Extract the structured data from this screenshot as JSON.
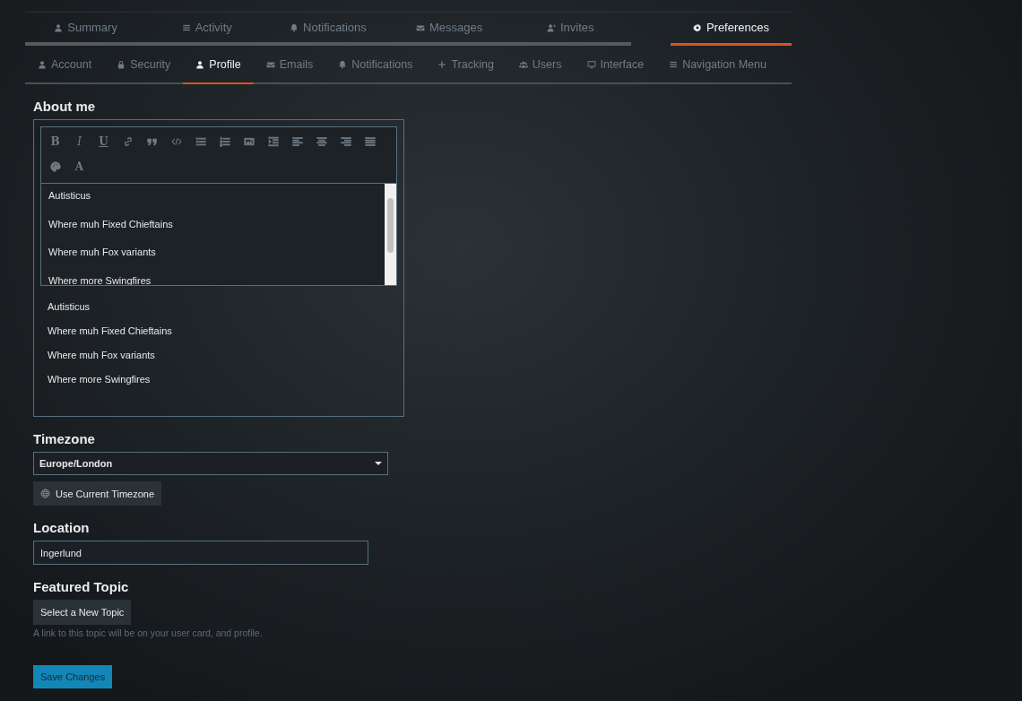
{
  "main_tabs": [
    {
      "label": "Summary",
      "kind": "user",
      "selected": false
    },
    {
      "label": "Activity",
      "kind": "list",
      "selected": false
    },
    {
      "label": "Notifications",
      "kind": "bell",
      "selected": false
    },
    {
      "label": "Messages",
      "kind": "envelope",
      "selected": false
    },
    {
      "label": "Invites",
      "kind": "user-plus",
      "selected": false
    },
    {
      "label": "Preferences",
      "kind": "gear",
      "selected": true
    }
  ],
  "sub_tabs": [
    {
      "label": "Account",
      "kind": "user",
      "selected": false
    },
    {
      "label": "Security",
      "kind": "lock",
      "selected": false
    },
    {
      "label": "Profile",
      "kind": "user",
      "selected": true
    },
    {
      "label": "Emails",
      "kind": "envelope",
      "selected": false
    },
    {
      "label": "Notifications",
      "kind": "bell",
      "selected": false
    },
    {
      "label": "Tracking",
      "kind": "plus",
      "selected": false
    },
    {
      "label": "Users",
      "kind": "users",
      "selected": false
    },
    {
      "label": "Interface",
      "kind": "monitor",
      "selected": false
    },
    {
      "label": "Navigation Menu",
      "kind": "list",
      "selected": false
    }
  ],
  "about_me": {
    "title": "About me",
    "toolbar": [
      {
        "kind": "bold",
        "text": "B"
      },
      {
        "kind": "italic",
        "text": "I"
      },
      {
        "kind": "underline",
        "text": "U"
      },
      {
        "kind": "link"
      },
      {
        "kind": "quote"
      },
      {
        "kind": "code"
      },
      {
        "kind": "bullets"
      },
      {
        "kind": "numbers"
      },
      {
        "kind": "image"
      },
      {
        "kind": "indent"
      },
      {
        "kind": "align-left"
      },
      {
        "kind": "align-center"
      },
      {
        "kind": "align-right"
      },
      {
        "kind": "justify"
      },
      {
        "kind": "palette"
      },
      {
        "kind": "font",
        "text": "A"
      }
    ],
    "editor_lines": [
      "Autisticus",
      "Where muh Fixed Chieftains",
      "Where muh Fox variants",
      "Where more Swingfires"
    ],
    "preview_lines": [
      "Autisticus",
      "Where muh Fixed Chieftains",
      "Where muh Fox variants",
      "Where more Swingfires"
    ]
  },
  "timezone": {
    "title": "Timezone",
    "value": "Europe/London",
    "button": "Use Current Timezone"
  },
  "location": {
    "title": "Location",
    "value": "Ingerlund"
  },
  "featured_topic": {
    "title": "Featured Topic",
    "button": "Select a New Topic",
    "hint": "A link to this topic will be on your user card, and profile."
  },
  "save_button": "Save Changes"
}
